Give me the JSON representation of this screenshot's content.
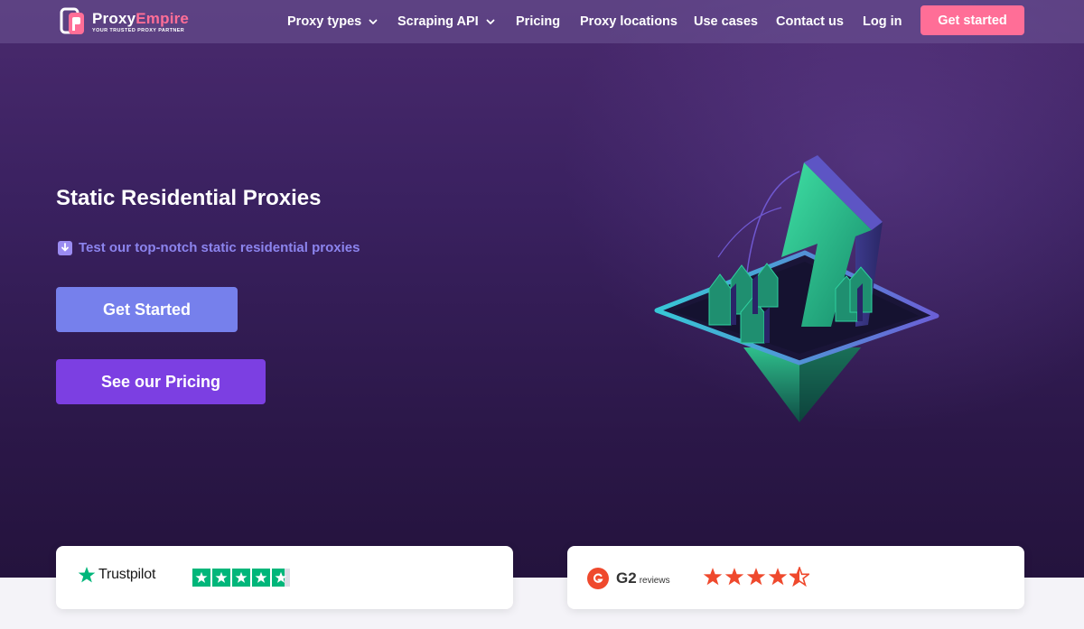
{
  "brand": {
    "name_part1": "Proxy",
    "name_part2": "Empire",
    "tagline": "YOUR TRUSTED PROXY PARTNER",
    "accent_color": "#ff6e97"
  },
  "nav": {
    "items": [
      {
        "label": "Proxy types",
        "has_dropdown": true
      },
      {
        "label": "Scraping API",
        "has_dropdown": true
      },
      {
        "label": "Pricing",
        "has_dropdown": false
      },
      {
        "label": "Proxy locations",
        "has_dropdown": false
      },
      {
        "label": "Use cases",
        "has_dropdown": false
      },
      {
        "label": "Contact us",
        "has_dropdown": false
      },
      {
        "label": "Log in",
        "has_dropdown": false
      }
    ],
    "cta_label": "Get started"
  },
  "hero": {
    "title": "Static Residential Proxies",
    "subtitle_icon": "down-arrow-icon",
    "subtitle": "Test our top-notch static residential proxies",
    "primary_button": "Get Started",
    "secondary_button": "See our Pricing"
  },
  "reviews": {
    "trustpilot": {
      "name": "Trustpilot",
      "rating": 4.7,
      "max": 5,
      "color": "#00b67a"
    },
    "g2": {
      "name": "G2",
      "sub": "reviews",
      "rating": 4.5,
      "max": 5,
      "color": "#ef492d"
    }
  }
}
